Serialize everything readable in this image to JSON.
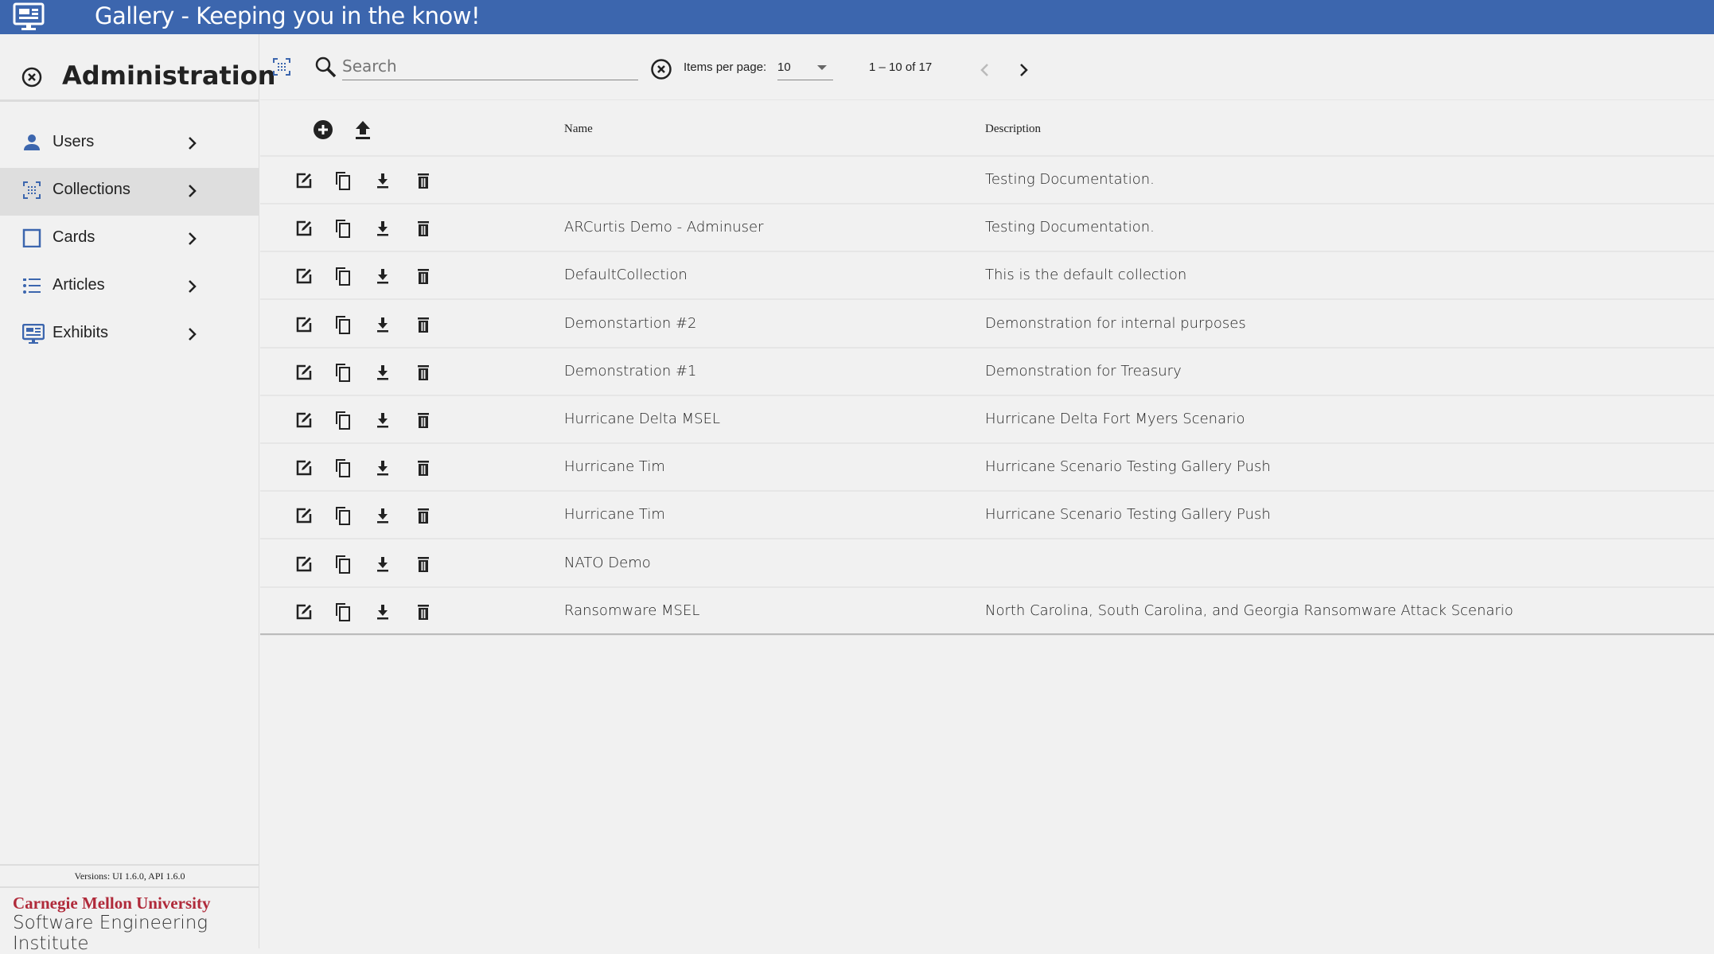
{
  "header": {
    "title": "Gallery - Keeping you in the know!",
    "icon": "monitor-dashboard-icon",
    "color": "#3c66ae"
  },
  "sidebar": {
    "title": "Administration",
    "items": [
      {
        "label": "Users",
        "icon": "person-icon"
      },
      {
        "label": "Collections",
        "icon": "collection-icon",
        "active": true
      },
      {
        "label": "Cards",
        "icon": "card-icon"
      },
      {
        "label": "Articles",
        "icon": "list-icon"
      },
      {
        "label": "Exhibits",
        "icon": "monitor-icon"
      }
    ],
    "versions": "Versions: UI 1.6.0, API 1.6.0",
    "logo_line1": "Carnegie Mellon University",
    "logo_line2": "Software Engineering Institute"
  },
  "toolbar": {
    "search_placeholder": "Search",
    "search_value": "",
    "items_per_page_label": "Items per page:",
    "items_per_page": "10",
    "range": "1 – 10 of 17"
  },
  "table": {
    "columns": [
      "Name",
      "Description"
    ],
    "rows": [
      {
        "name": "",
        "description": "Testing Documentation."
      },
      {
        "name": "ARCurtis Demo - Adminuser",
        "description": "Testing Documentation."
      },
      {
        "name": "DefaultCollection",
        "description": "This is the default collection"
      },
      {
        "name": "Demonstartion #2",
        "description": "Demonstration for internal purposes"
      },
      {
        "name": "Demonstration #1",
        "description": "Demonstration for Treasury"
      },
      {
        "name": "Hurricane Delta MSEL",
        "description": "Hurricane Delta Fort Myers Scenario"
      },
      {
        "name": "Hurricane Tim",
        "description": "Hurricane Scenario Testing Gallery Push"
      },
      {
        "name": "Hurricane Tim",
        "description": "Hurricane Scenario Testing Gallery Push"
      },
      {
        "name": "NATO Demo",
        "description": ""
      },
      {
        "name": "Ransomware MSEL",
        "description": "North Carolina, South Carolina, and Georgia Ransomware Attack Scenario"
      }
    ]
  }
}
